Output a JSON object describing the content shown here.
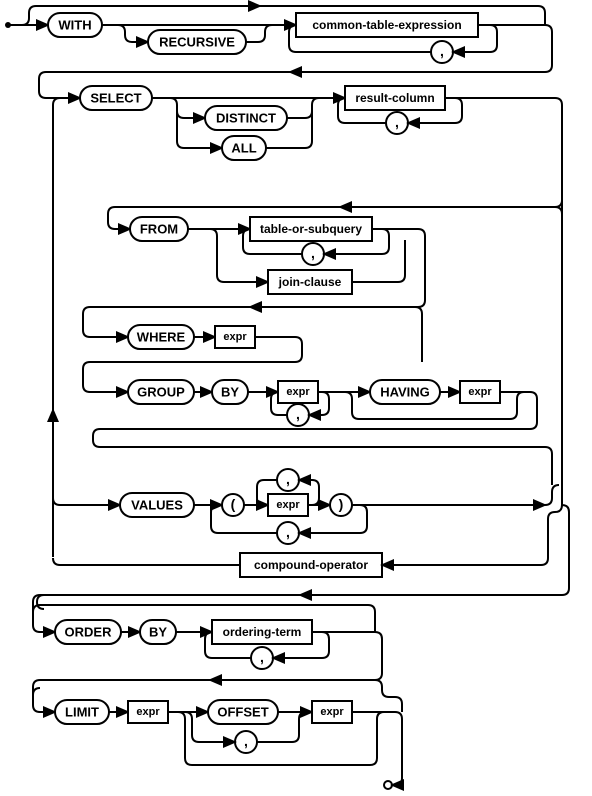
{
  "diagram": {
    "type": "railroad-syntax-diagram",
    "language": "SQL",
    "statement": "select-stmt"
  },
  "keywords": {
    "with": "WITH",
    "recursive": "RECURSIVE",
    "select": "SELECT",
    "distinct": "DISTINCT",
    "all": "ALL",
    "from": "FROM",
    "where": "WHERE",
    "group": "GROUP",
    "by": "BY",
    "by2": "BY",
    "having": "HAVING",
    "values": "VALUES",
    "order": "ORDER",
    "limit": "LIMIT",
    "offset": "OFFSET"
  },
  "subrules": {
    "cte": "common-table-expression",
    "result_column": "result-column",
    "table_or_subquery": "table-or-subquery",
    "join_clause": "join-clause",
    "expr": "expr",
    "ordering_term": "ordering-term",
    "compound_operator": "compound-operator"
  },
  "terminals": {
    "comma": ",",
    "lparen": "(",
    "rparen": ")"
  }
}
